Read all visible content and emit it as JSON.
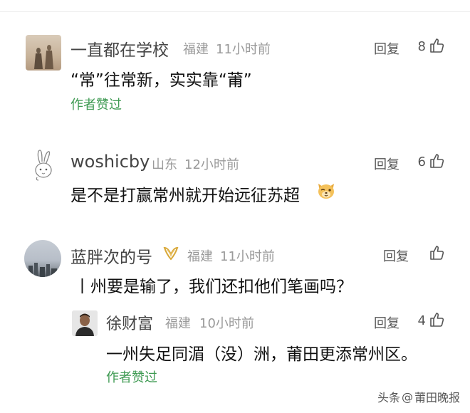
{
  "comments": [
    {
      "user": "一直都在学校",
      "location": "福建",
      "time": "11小时前",
      "reply_label": "回复",
      "likes": "8",
      "text": "“常”往常新，实实靠“莆”",
      "author_liked": "作者赞过",
      "avatar_icon": "shadow-photo-avatar"
    },
    {
      "user": "woshicby",
      "location": "山东",
      "time": "12小时前",
      "reply_label": "回复",
      "likes": "6",
      "text": "是不是打赢常州就开始远征苏超",
      "emoji_icon": "dog-face-emoji-icon",
      "avatar_icon": "rabbit-avatar"
    },
    {
      "user": "蓝胖次的号",
      "location": "福建",
      "time": "11小时前",
      "reply_label": "回复",
      "likes": "",
      "text": "丨州要是输了，我们还扣他们笔画吗？",
      "badge_icon": "gold-ribbon-badge-icon",
      "avatar_icon": "sky-photo-avatar",
      "replies": [
        {
          "user": "徐财富",
          "location": "福建",
          "time": "10小时前",
          "reply_label": "回复",
          "likes": "4",
          "text": "一州失足同湄（没）洲，莆田更添常州区。",
          "author_liked": "作者赞过",
          "avatar_icon": "man-photo-avatar"
        }
      ]
    }
  ],
  "watermark": {
    "prefix": "头条",
    "at": "@",
    "account": "莆田晚报"
  },
  "colors": {
    "author_liked": "#3e9a52",
    "meta": "#9a9a9a",
    "name": "#454545"
  }
}
